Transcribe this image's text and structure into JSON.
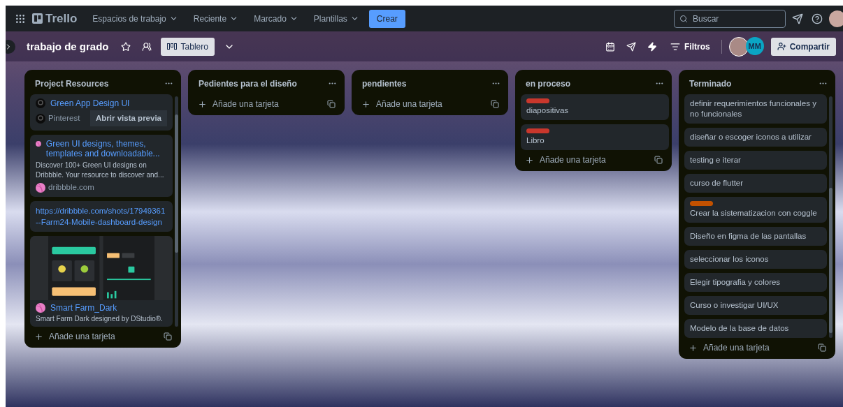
{
  "nav": {
    "brand": "Trello",
    "menus": [
      {
        "label": "Espacios de trabajo"
      },
      {
        "label": "Reciente"
      },
      {
        "label": "Marcado"
      },
      {
        "label": "Plantillas"
      }
    ],
    "create": "Crear",
    "search": {
      "placeholder": "Buscar"
    }
  },
  "board": {
    "title": "trabajo de grado",
    "view": "Tablero",
    "filters": "Filtros",
    "members": [
      {
        "kind": "photo"
      },
      {
        "kind": "initials",
        "initials": "MM"
      }
    ],
    "share": "Compartir"
  },
  "lists": [
    {
      "title": "Project Resources",
      "add": "Añade una tarjeta",
      "cards": [
        {
          "kind": "embed",
          "title": "Green App Design UI",
          "source": "Pinterest",
          "action": "Abrir vista previa"
        },
        {
          "kind": "rich",
          "title": "Green UI designs, themes, templates and downloadable...",
          "description": "Discover 100+ Green UI designs on Dribbble. Your resource to discover and...",
          "source": "dribbble.com"
        },
        {
          "kind": "url",
          "text": "https://dribbble.com/shots/17949361--Farm24-Mobile-dashboard-design"
        },
        {
          "kind": "image",
          "title": "Smart Farm_Dark",
          "description": "Smart Farm Dark designed by DStudio®."
        }
      ]
    },
    {
      "title": "Pedientes para el diseño",
      "add": "Añade una tarjeta"
    },
    {
      "title": "pendientes",
      "add": "Añade una tarjeta"
    },
    {
      "title": "en proceso",
      "add": "Añade una tarjeta",
      "cards": [
        {
          "kind": "plain",
          "text": "diapositivas",
          "color": "#c9372c"
        },
        {
          "kind": "plain",
          "text": "Libro",
          "color": "#c9372c"
        }
      ]
    },
    {
      "title": "Terminado",
      "add": "Añade una tarjeta",
      "cards": [
        {
          "kind": "plain",
          "text": "definir requerimientos funcionales y no funcionales"
        },
        {
          "kind": "plain",
          "text": "diseñar o escoger iconos a utilizar"
        },
        {
          "kind": "plain",
          "text": "testing e iterar"
        },
        {
          "kind": "plain",
          "text": "curso de flutter"
        },
        {
          "kind": "plain",
          "text": "Crear la sistematizacion con coggle",
          "color": "#c25100"
        },
        {
          "kind": "plain",
          "text": "Diseño en figma de las pantallas"
        },
        {
          "kind": "plain",
          "text": "seleccionar los iconos"
        },
        {
          "kind": "plain",
          "text": "Elegir tipografia y colores"
        },
        {
          "kind": "plain",
          "text": "Curso o investigar UI/UX"
        },
        {
          "kind": "plain",
          "text": "Modelo de la base de datos"
        }
      ]
    }
  ]
}
